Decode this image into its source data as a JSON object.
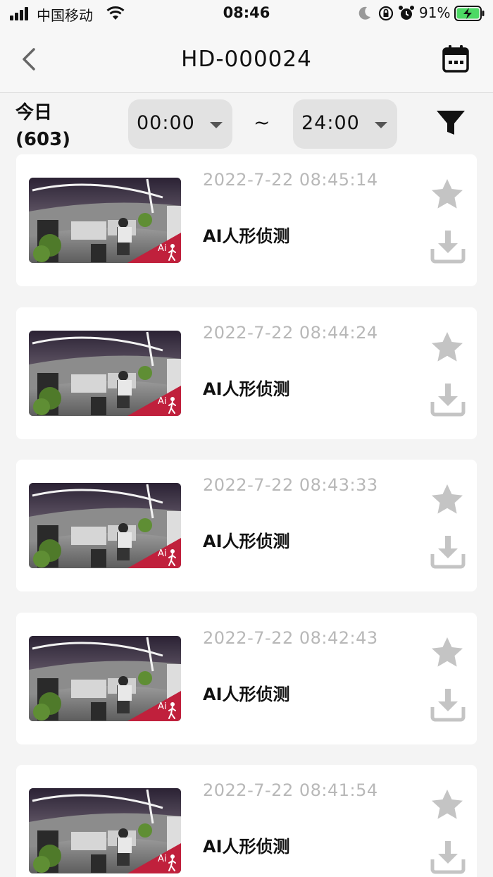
{
  "status_bar": {
    "carrier": "中国移动",
    "time": "08:46",
    "battery": "91%",
    "icons": [
      "signal-icon",
      "wifi-icon",
      "moon-icon",
      "rotation-lock-icon",
      "alarm-icon",
      "battery-charging-icon"
    ]
  },
  "header": {
    "title": "HD-000024",
    "back_icon": "chevron-left-icon",
    "calendar_icon": "calendar-icon"
  },
  "filter": {
    "day_label": "今日",
    "count": "(603)",
    "start_time": "00:00",
    "separator": "~",
    "end_time": "24:00",
    "filter_icon": "funnel-icon"
  },
  "records": [
    {
      "time": "2022-7-22 08:45:14",
      "event": "AI人形侦测",
      "badge": "Ai"
    },
    {
      "time": "2022-7-22 08:44:24",
      "event": "AI人形侦测",
      "badge": "Ai"
    },
    {
      "time": "2022-7-22 08:43:33",
      "event": "AI人形侦测",
      "badge": "Ai"
    },
    {
      "time": "2022-7-22 08:42:43",
      "event": "AI人形侦测",
      "badge": "Ai"
    },
    {
      "time": "2022-7-22 08:41:54",
      "event": "AI人形侦测",
      "badge": "Ai"
    }
  ],
  "colors": {
    "badge": "#c0203c",
    "icon_gray": "#c4c4c4",
    "time_gray": "#b8b8b8"
  }
}
